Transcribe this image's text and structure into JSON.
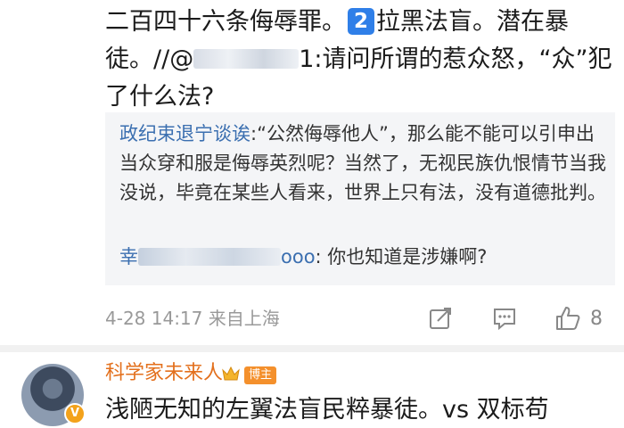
{
  "post": {
    "text_part1": "二百四十六条侮辱罪。",
    "badge": "2",
    "text_part2": "拉黑法盲。潜在暴徒。//@",
    "mention_tail": "1",
    "text_part3": ":请问所谓的惹众怒，“众”犯了什么法?"
  },
  "quote": {
    "user1_name": "政纪束退宁谈诶",
    "comment1": ":“公然侮辱他人”，那么能不能可以引申出当众穿和服是侮辱英烈呢？当然了，无视民族仇恨情节当我没说，毕竟在某些人看来，世界上只有法，没有道德批判。",
    "user2_visible_start": "幸",
    "user2_visible_end": "ooo",
    "comment2": ": 你也知道是涉嫌啊?"
  },
  "meta": {
    "date": "4-28 14:17",
    "location": "来自上海",
    "like_count": "8"
  },
  "next_comment": {
    "username": "科学家未来人",
    "role": "博主",
    "verified_mark": "V",
    "text": "浅陋无知的左翼法盲民粹暴徒。vs 双标苟"
  },
  "colors": {
    "accent_blue": "#2f7fe8",
    "username_orange": "#e3701d",
    "badge_orange": "#f4902c"
  },
  "icons": [
    "share-icon",
    "comment-icon",
    "like-icon",
    "crown-icon",
    "verified-icon"
  ]
}
